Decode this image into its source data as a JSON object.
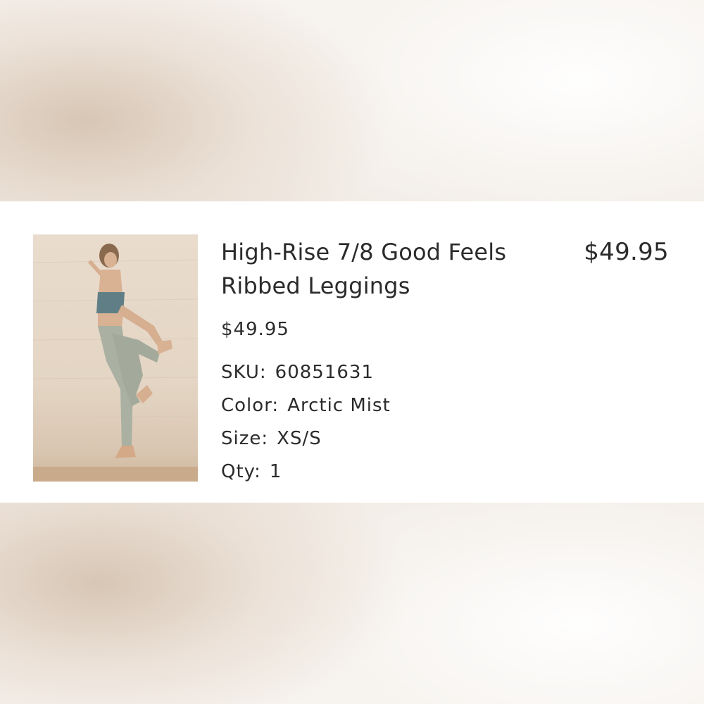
{
  "product": {
    "title": "High-Rise 7/8 Good Feels Ribbed Leggings",
    "price": "$49.95",
    "unit_price": "$49.95",
    "sku_label": "SKU:",
    "sku_value": "60851631",
    "color_label": "Color:",
    "color_value": "Arctic Mist",
    "size_label": "Size:",
    "size_value": "XS/S",
    "qty_label": "Qty:",
    "qty_value": "1"
  },
  "colors": {
    "text": "#2b2b2b",
    "card_bg": "#ffffff",
    "page_bg": "#f4efea"
  }
}
